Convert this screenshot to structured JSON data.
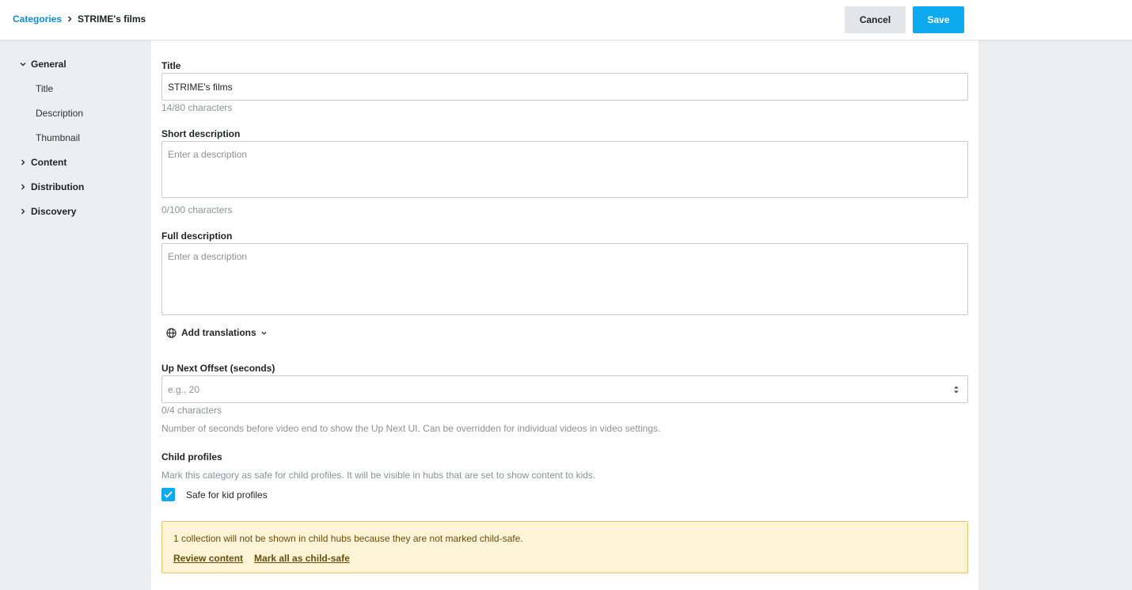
{
  "header": {
    "breadcrumb_root": "Categories",
    "breadcrumb_current": "STRIME's films",
    "cancel_label": "Cancel",
    "save_label": "Save"
  },
  "sidebar": {
    "groups": [
      {
        "label": "General",
        "expanded": true,
        "items": [
          "Title",
          "Description",
          "Thumbnail"
        ]
      },
      {
        "label": "Content",
        "expanded": false
      },
      {
        "label": "Distribution",
        "expanded": false
      },
      {
        "label": "Discovery",
        "expanded": false
      }
    ]
  },
  "form": {
    "title": {
      "label": "Title",
      "value": "STRIME's films",
      "counter": "14/80 characters"
    },
    "short_description": {
      "label": "Short description",
      "placeholder": "Enter a description",
      "counter": "0/100 characters"
    },
    "full_description": {
      "label": "Full description",
      "placeholder": "Enter a description"
    },
    "add_translations_label": "Add translations",
    "up_next": {
      "label": "Up Next Offset (seconds)",
      "placeholder": "e.g., 20",
      "counter": "0/4 characters",
      "help": "Number of seconds before video end to show the Up Next UI. Can be overridden for individual videos in video settings."
    },
    "child_profiles": {
      "label": "Child profiles",
      "help": "Mark this category as safe for child profiles. It will be visible in hubs that are set to show content to kids.",
      "checkbox_label": "Safe for kid profiles",
      "checked": true
    },
    "warning": {
      "text": "1 collection will not be shown in child hubs because they are not marked child-safe.",
      "review_label": "Review content",
      "mark_all_label": "Mark all as child-safe"
    }
  },
  "colors": {
    "accent": "#0eaaf0",
    "link": "#0a8ed6",
    "warning_bg": "#fdf4d8",
    "warning_border": "#e9c46a"
  }
}
